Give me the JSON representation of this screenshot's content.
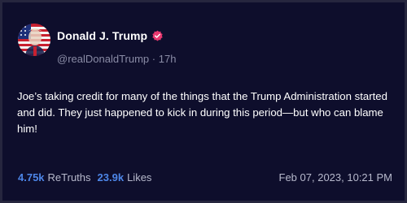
{
  "post": {
    "author": {
      "display_name": "Donald J. Trump",
      "handle": "@realDonaldTrump",
      "age": "17h",
      "separator": "·",
      "verified_icon": "verified-badge-icon",
      "avatar_icon": "profile-avatar"
    },
    "text": "Joe’s taking credit for many of the things that the Trump Administration started and did. They just happened to kick in during this period—but who can blame him!",
    "stats": {
      "retruths_count": "4.75k",
      "retruths_label": "ReTruths",
      "likes_count": "23.9k",
      "likes_label": "Likes"
    },
    "timestamp": "Feb 07, 2023, 10:21 PM"
  },
  "colors": {
    "background": "#0e0e2c",
    "accent_blue": "#4d86e8",
    "muted_text": "#8a8ca6",
    "verified_badge": "#e8386f"
  }
}
